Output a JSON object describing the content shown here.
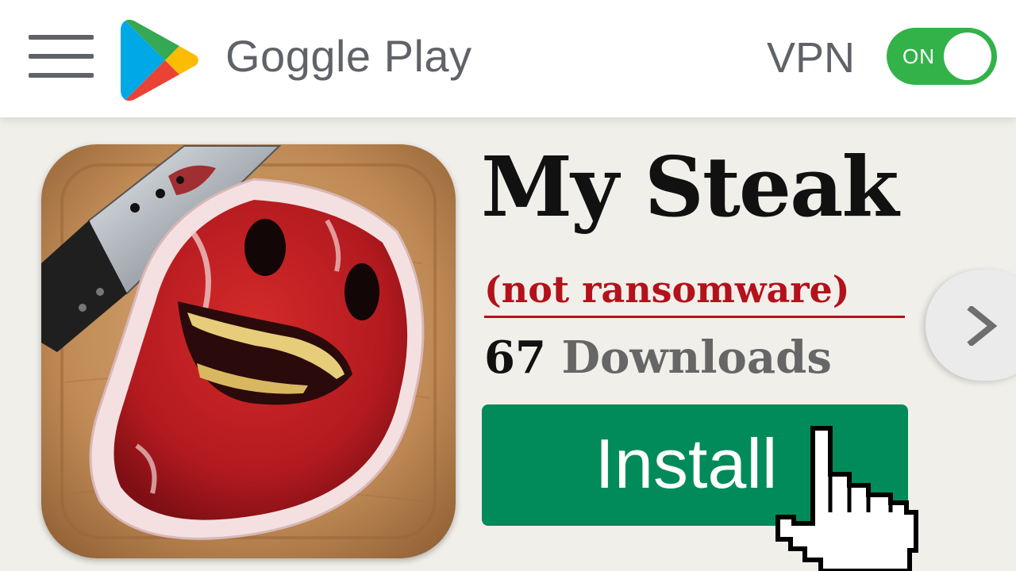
{
  "header": {
    "menu_icon": "hamburger-menu-icon",
    "logo_icon": "play-store-logo-icon",
    "brand": "Goggle Play",
    "vpn": {
      "label": "VPN",
      "toggle_text": "ON",
      "state": "on"
    }
  },
  "app": {
    "icon": "steak-face-icon",
    "title": "My Steak",
    "subtitle": "(not ransomware)",
    "downloads_count": "67",
    "downloads_label": "Downloads",
    "install_label": "Install"
  },
  "nav": {
    "next_icon": "chevron-right-icon"
  },
  "pointer": {
    "icon": "pointer-hand-cursor-icon"
  },
  "colors": {
    "install_green": "#018b5b",
    "toggle_green": "#33b24a",
    "subtitle_red": "#b3121b",
    "header_gray": "#5f6368",
    "background": "#f1efea"
  }
}
